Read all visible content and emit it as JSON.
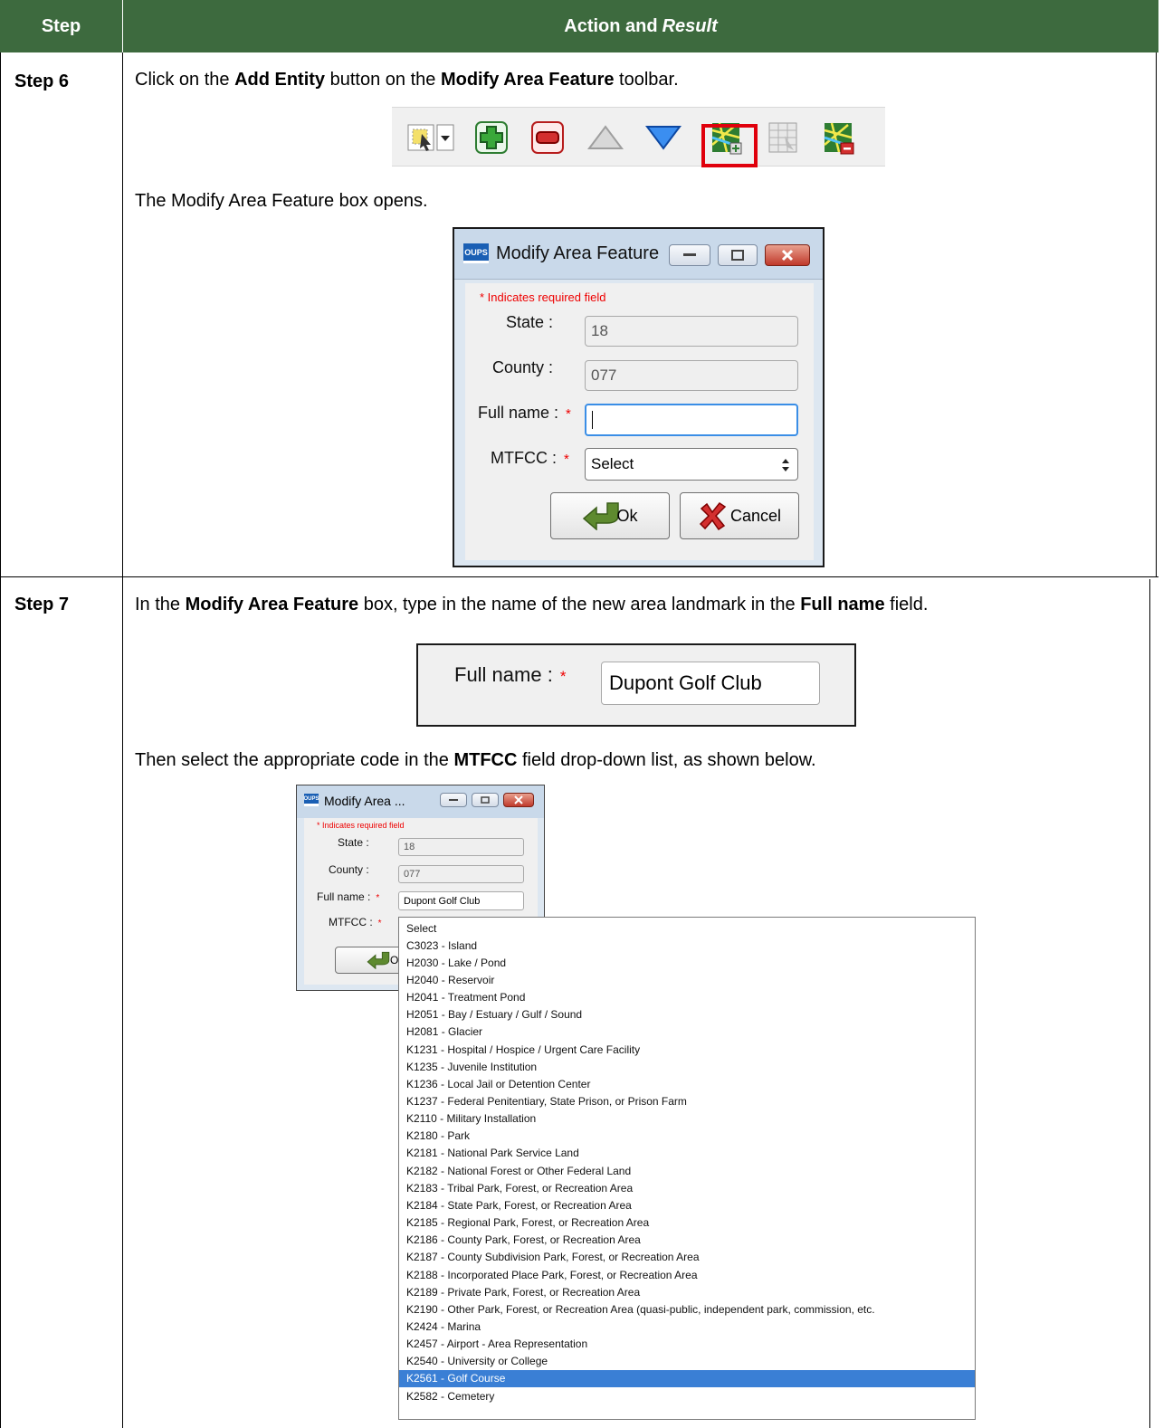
{
  "header": {
    "step": "Step",
    "action": "Action and",
    "result": "Result"
  },
  "step6": {
    "label": "Step 6",
    "p1_a": "Click on the ",
    "p1_b": "Add Entity",
    "p1_c": " button on the ",
    "p1_d": "Modify Area Feature",
    "p1_e": " toolbar.",
    "p2": "The Modify Area Feature box opens.",
    "toolbar_icons": [
      "select-tool-icon",
      "add-green-plus-icon",
      "remove-red-minus-icon",
      "up-triangle-icon",
      "down-triangle-icon",
      "add-entity-map-icon",
      "table-grid-icon",
      "remove-entity-map-icon"
    ],
    "dialog": {
      "title": "Modify Area Feature",
      "logo": "OUPS",
      "required_note": "* Indicates required field",
      "state_label": "State :",
      "state_value": "18",
      "county_label": "County :",
      "county_value": "077",
      "fullname_label": "Full name :",
      "fullname_value": "",
      "mtfcc_label": "MTFCC :",
      "mtfcc_value": "Select",
      "ok_label": "Ok",
      "cancel_label": "Cancel",
      "star": "*"
    }
  },
  "step7": {
    "label": "Step 7",
    "p1_a": "In the ",
    "p1_b": "Modify Area Feature",
    "p1_c": " box, type in the name of the new area landmark in the ",
    "p1_d": "Full name",
    "p1_e": " field.",
    "zoom_label": "Full name :",
    "zoom_value": "Dupont Golf Club",
    "p2_a": "Then select the appropriate code in the ",
    "p2_b": "MTFCC",
    "p2_c": " field drop-down list, as shown below.",
    "dialog": {
      "title": "Modify Area ...",
      "required_note": "* Indicates required field",
      "state_label": "State :",
      "state_value": "18",
      "county_label": "County :",
      "county_value": "077",
      "fullname_label": "Full name :",
      "fullname_value": "Dupont Golf Club",
      "mtfcc_label": "MTFCC :",
      "ok_partial": "Ol"
    },
    "options": [
      "Select",
      "C3023 - Island",
      "H2030 - Lake / Pond",
      "H2040 - Reservoir",
      "H2041 - Treatment Pond",
      "H2051 - Bay / Estuary / Gulf / Sound",
      "H2081 - Glacier",
      "K1231 - Hospital / Hospice / Urgent Care Facility",
      "K1235 - Juvenile Institution",
      "K1236 - Local Jail or Detention Center",
      "K1237 - Federal Penitentiary, State Prison, or Prison Farm",
      "K2110 - Military Installation",
      "K2180 - Park",
      "K2181 - National Park Service Land",
      "K2182 - National Forest or Other Federal Land",
      "K2183 - Tribal Park, Forest, or Recreation Area",
      "K2184 - State Park, Forest, or Recreation Area",
      "K2185 - Regional Park, Forest, or Recreation Area",
      "K2186 - County Park, Forest, or Recreation Area",
      "K2187 - County Subdivision Park, Forest, or Recreation Area",
      "K2188 - Incorporated Place Park, Forest, or Recreation Area",
      "K2189 - Private Park, Forest, or Recreation Area",
      "K2190 - Other Park, Forest, or Recreation Area (quasi-public, independent park, commission, etc.",
      "K2424 - Marina",
      "K2457 - Airport - Area Representation",
      "K2540 - University or College",
      "K2561 - Golf Course",
      "K2582 - Cemetery"
    ],
    "selected_option": "K2561 - Golf Course"
  },
  "colors": {
    "header_bg": "#3d6a3e",
    "highlight": "#e0000c",
    "selection": "#3a7fd5"
  }
}
